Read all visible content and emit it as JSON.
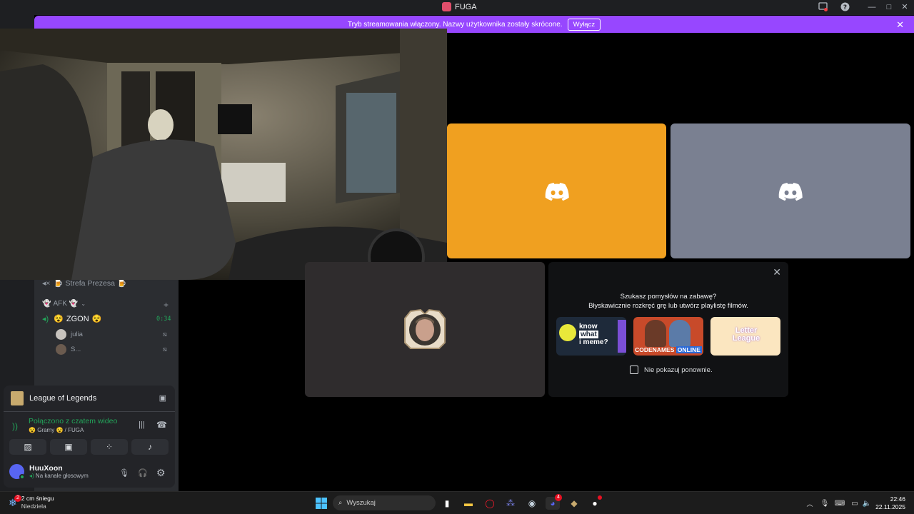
{
  "window": {
    "title": "FUGA",
    "controls": [
      "inbox-icon",
      "help-icon",
      "minimize-icon",
      "maximize-icon",
      "close-icon"
    ]
  },
  "banner": {
    "text": "Tryb streamowania włączony. Nazwy użytkownika zostały skrócone.",
    "button_label": "Wyłącz",
    "color": "#9747ff"
  },
  "channels": {
    "strefa": "Strefa Prezesa",
    "afk": "AFK",
    "zgon": "ZGON",
    "zgon_timer": "0:34",
    "users": [
      {
        "name": "julia"
      },
      {
        "name": "S..."
      }
    ]
  },
  "activity": {
    "title_line1": "Szukasz pomysłów na zabawę?",
    "title_line2": "Błyskawicznie rozkręć grę lub utwórz playlistę filmów.",
    "cards": [
      {
        "line1": "know",
        "line2": "what",
        "line3": "i meme?"
      },
      {
        "line1": "CODENAMES",
        "line2": "ONLINE"
      },
      {
        "line1": "Letter",
        "line2": "League"
      }
    ],
    "checkbox_label": "Nie pokazuj ponownie."
  },
  "tiles": {
    "orange": "#f0a020",
    "gray": "#7a8091"
  },
  "voice": {
    "game": "League of Legends",
    "status": "Połączono z czatem wideo",
    "channel_prefix": "Gramy",
    "channel_suffix": "/ FUGA",
    "status_color": "#23a55a"
  },
  "user": {
    "name": "HuuXoon",
    "status": "Na kanale głosowym"
  },
  "taskbar": {
    "weather_badge": "2",
    "weather_line1": "2 cm śniegu",
    "weather_line2": "Niedziela",
    "search_placeholder": "Wyszukaj",
    "discord_badge": "4",
    "time": "22:46",
    "date": "22.11.2025"
  }
}
